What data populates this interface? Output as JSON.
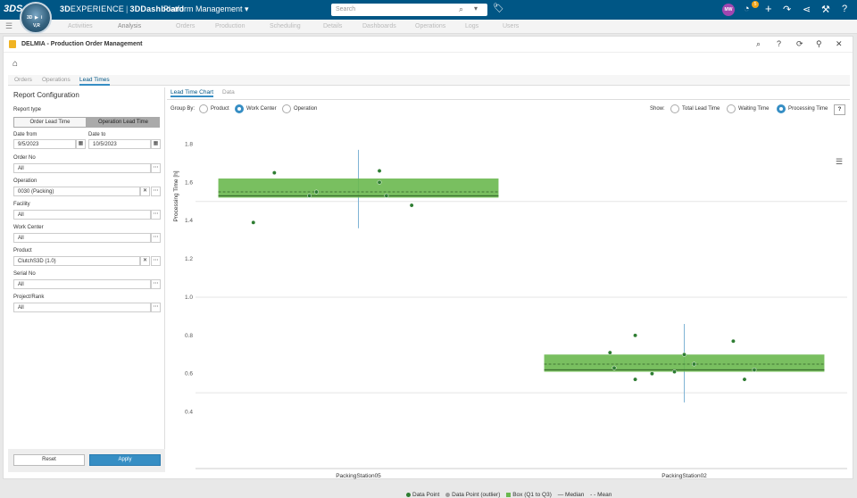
{
  "topbar": {
    "ds_logo": "3DS",
    "compass_top": "3D",
    "compass_play": "▶",
    "compass_i": "i",
    "compass_vr": "V,R",
    "brand_3d": "3D",
    "brand_experience": "EXPERIENCE",
    "brand_app": "3DDashboard",
    "platform_label": "Platform Management",
    "search_placeholder": "Search",
    "user_initials": "MW",
    "notification_count": "5"
  },
  "tabs": [
    "Activities",
    "Analysis",
    "Orders",
    "Production",
    "Scheduling",
    "Details",
    "Dashboards",
    "Operations",
    "Logs",
    "Users"
  ],
  "widget": {
    "title": "DELMIA - Production Order Management",
    "subtabs": [
      "Orders",
      "Operations",
      "Lead Times"
    ],
    "active_subtab": "Lead Times"
  },
  "config": {
    "title": "Report Configuration",
    "report_type_label": "Report type",
    "report_type_options": [
      "Order Lead Time",
      "Operation Lead Time"
    ],
    "report_type_selected": "Operation Lead Time",
    "date_from_label": "Date from",
    "date_from_value": "9/5/2023",
    "date_to_label": "Date to",
    "date_to_value": "10/5/2023",
    "fields": [
      {
        "label": "Order No",
        "value": "All",
        "clearable": false
      },
      {
        "label": "Operation",
        "value": "0030 (Packing)",
        "clearable": true
      },
      {
        "label": "Facility",
        "value": "All",
        "clearable": false
      },
      {
        "label": "Work Center",
        "value": "All",
        "clearable": false
      },
      {
        "label": "Product",
        "value": "ClutchS3D (1.0)",
        "clearable": true
      },
      {
        "label": "Serial No",
        "value": "All",
        "clearable": false
      },
      {
        "label": "Project/Rank",
        "value": "All",
        "clearable": false
      }
    ],
    "reset_label": "Reset",
    "apply_label": "Apply"
  },
  "chart_panel": {
    "tabs": [
      "Lead Time Chart",
      "Data"
    ],
    "active_tab": "Lead Time Chart",
    "group_by_label": "Group By:",
    "group_by_options": [
      "Product",
      "Work Center",
      "Operation"
    ],
    "group_by_selected": "Work Center",
    "show_label": "Show:",
    "show_options": [
      "Total Lead Time",
      "Waiting Time",
      "Processing Time"
    ],
    "show_selected": "Processing Time",
    "help_label": "?"
  },
  "colors": {
    "box_fill": "#6ab84f",
    "point": "#2e7d32",
    "outlier": "#9e9e9e",
    "whisker": "#7fb3d5",
    "accent": "#368ec4",
    "topbar": "#005685"
  },
  "legend": {
    "data_point": "Data Point",
    "outlier": "Data Point (outlier)",
    "box": "Box (Q1 to Q3)",
    "median": "Median",
    "mean": "Mean"
  },
  "chart_data": {
    "type": "boxplot",
    "ylabel": "Processing Time [h]",
    "ylim": [
      0.3,
      1.9
    ],
    "yticks": [
      0.4,
      0.6,
      0.8,
      1.0,
      1.2,
      1.4,
      1.6,
      1.8
    ],
    "categories": [
      "PackingStation05",
      "PackingStation02"
    ],
    "boxes": [
      {
        "category": "PackingStation05",
        "q1": 1.52,
        "q3": 1.62,
        "median": 1.53,
        "mean": 1.55,
        "whisker_low": 1.36,
        "whisker_high": 1.77,
        "points": [
          1.39,
          1.65,
          1.53,
          1.55,
          1.66,
          1.6,
          1.53,
          1.48
        ]
      },
      {
        "category": "PackingStation02",
        "q1": 0.61,
        "q3": 0.7,
        "median": 0.62,
        "mean": 0.65,
        "whisker_low": 0.45,
        "whisker_high": 0.86,
        "points": [
          0.71,
          0.63,
          0.8,
          0.57,
          0.6,
          0.61,
          0.7,
          0.65,
          0.77,
          0.57,
          0.62
        ]
      }
    ],
    "grid": true,
    "legend_position": "bottom"
  }
}
